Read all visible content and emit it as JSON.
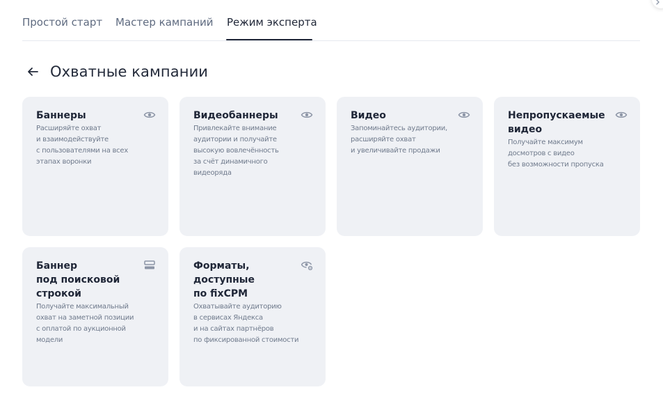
{
  "tabs": [
    {
      "label": "Простой старт"
    },
    {
      "label": "Мастер кампаний"
    },
    {
      "label": "Режим эксперта"
    }
  ],
  "active_tab": "Режим эксперта",
  "heading": {
    "title": "Охватные кампании",
    "back_icon": "arrow-left-icon"
  },
  "cards": [
    {
      "title": "Баннеры",
      "description": "Расширяйте охват\nи взаимодействуйте\nс пользователями на всех\nэтапах воронки",
      "icon": "eye-icon"
    },
    {
      "title": "Видеобаннеры",
      "description": "Привлекайте внимание\nаудитории и получайте\nвысокую вовлечённость\nза счёт динамичного\nвидеоряда",
      "icon": "eye-icon"
    },
    {
      "title": "Видео",
      "description": "Запоминайтесь аудитории,\nрасширяйте охват\nи увеличивайте продажи",
      "icon": "eye-icon"
    },
    {
      "title": "Непропускаемые\nвидео",
      "description": "Получайте максимум\nдосмотров с видео\nбез возможности пропуска",
      "icon": "eye-icon"
    },
    {
      "title": "Баннер\nпод поисковой\nстрокой",
      "description": "Получайте максимальный\nохват на заметной позиции\nс оплатой по аукционной\nмодели",
      "icon": "search-bar-icon"
    },
    {
      "title": "Форматы,\nдоступные\nпо fixCPM",
      "description": "Охватывайте аудиторию\nв сервисах Яндекса\nи на сайтах партнёров\nпо фиксированной стоимости",
      "icon": "eye-settings-icon"
    }
  ],
  "colors": {
    "card_bg": "#eff1f5",
    "icon": "#8c95a6",
    "title": "#1f2637",
    "desc": "#6f7a8c"
  }
}
